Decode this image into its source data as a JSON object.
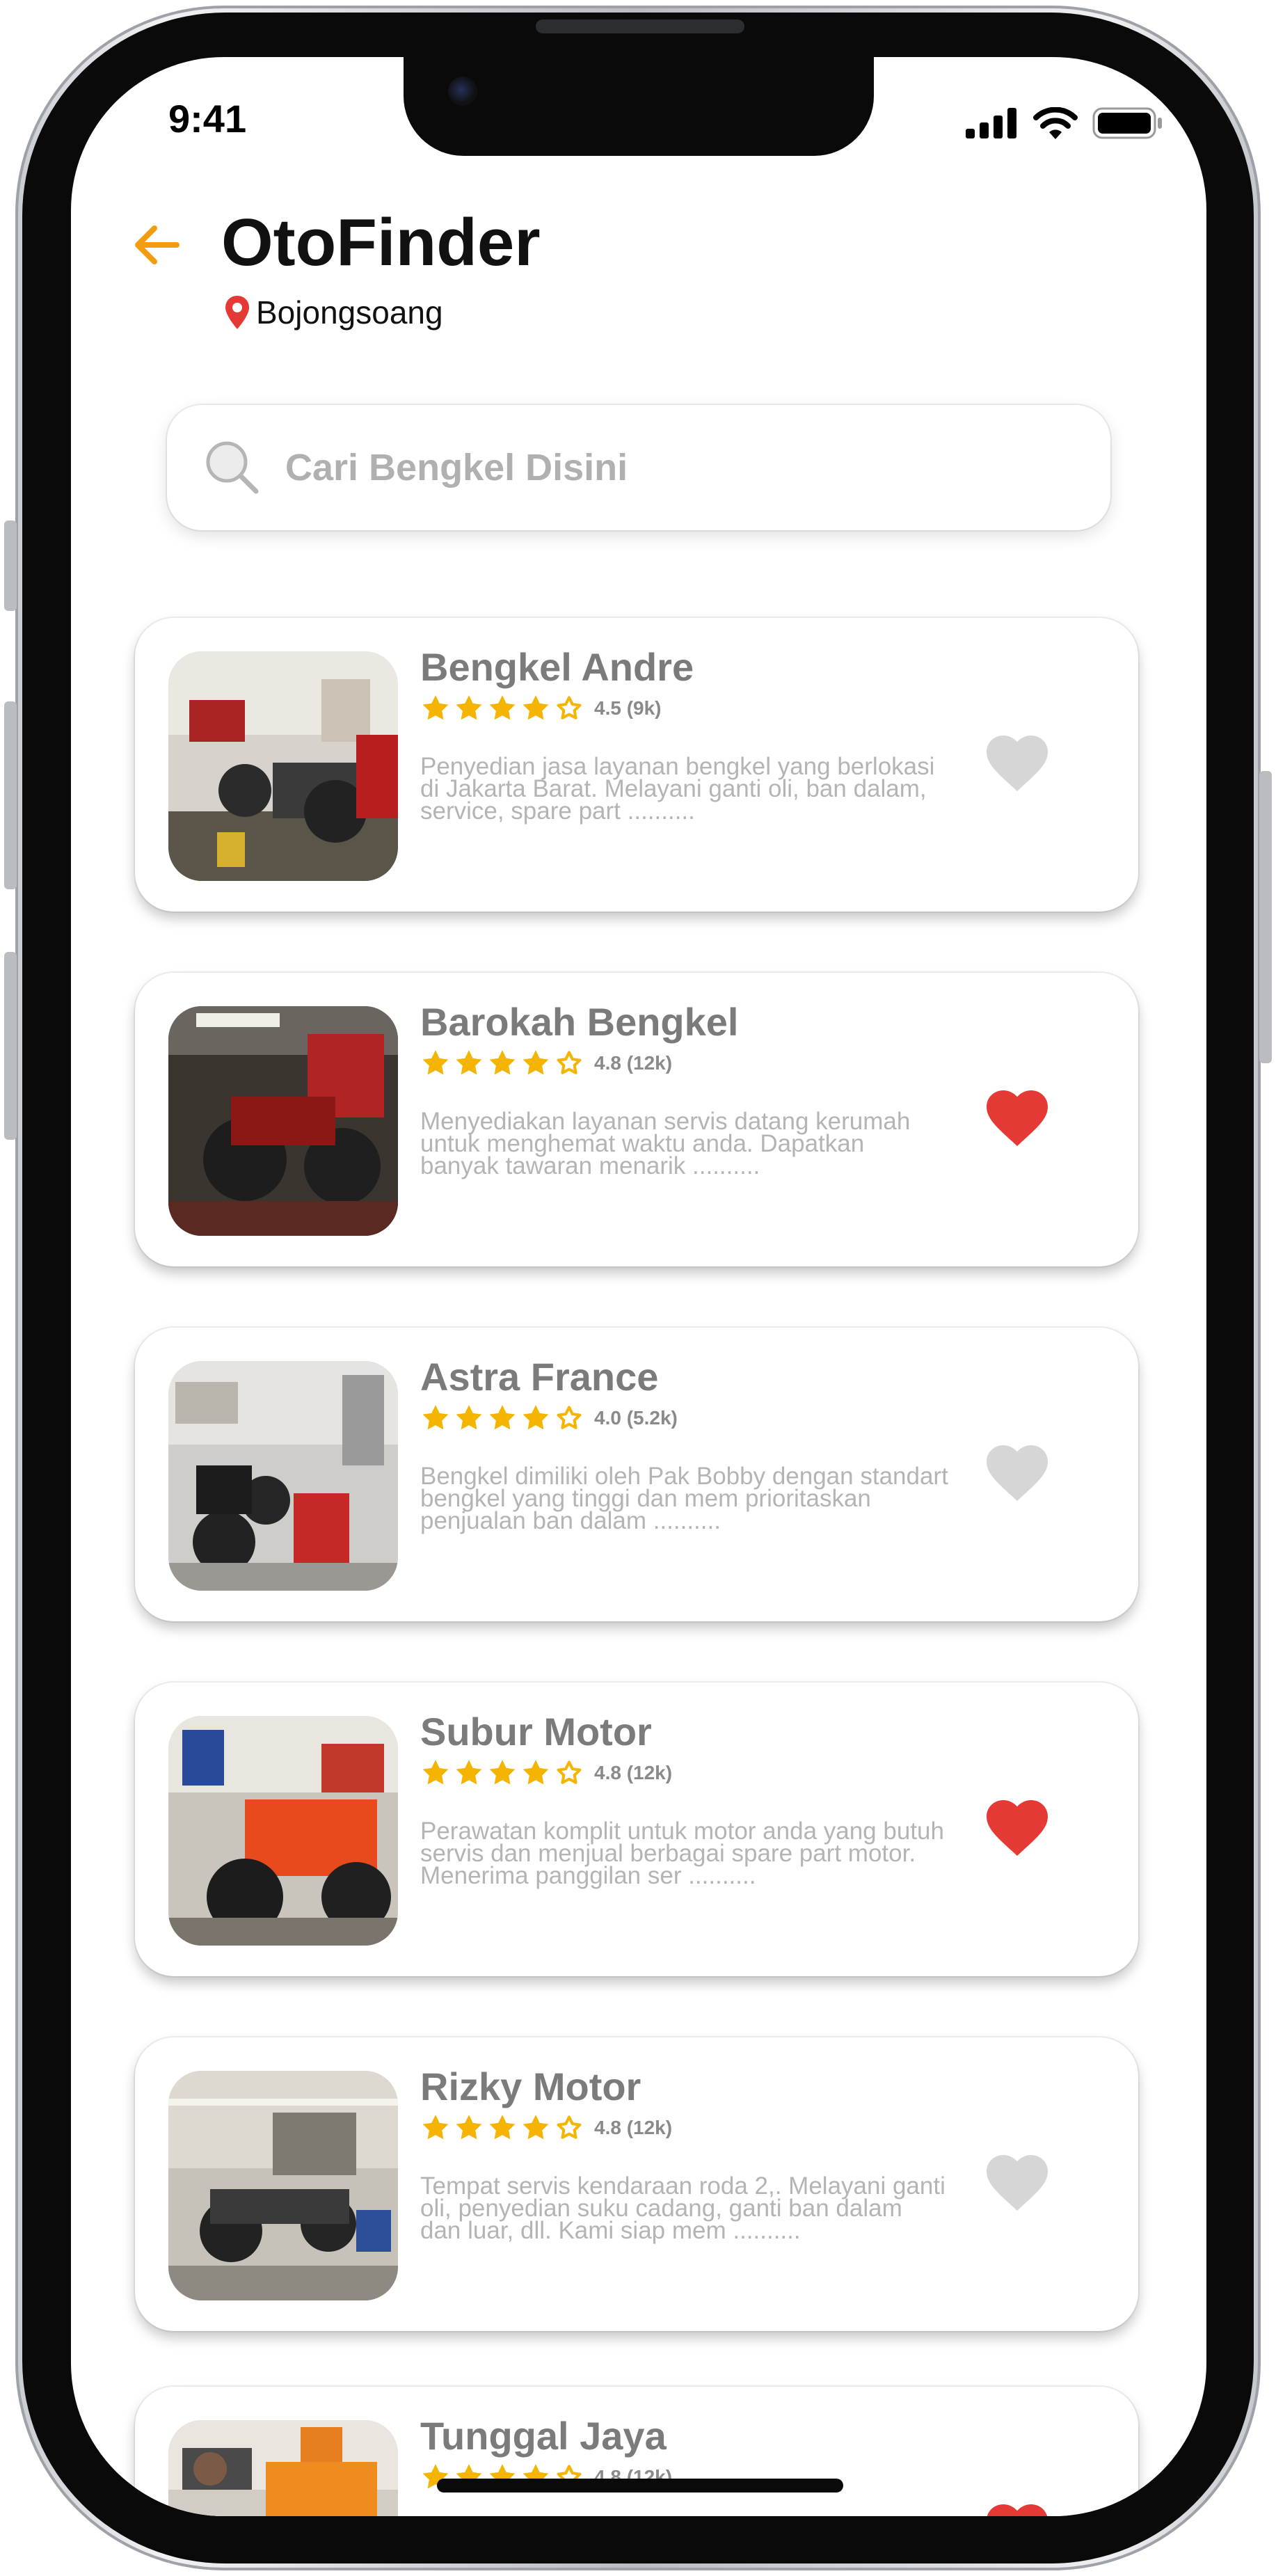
{
  "status_bar": {
    "time": "9:41"
  },
  "header": {
    "title": "OtoFinder",
    "location": "Bojongsoang"
  },
  "search": {
    "placeholder": "Cari Bengkel Disini"
  },
  "colors": {
    "accent": "#F39C12",
    "star": "#F4B400",
    "heart_active": "#E53935",
    "heart_inactive": "#D6D6D6",
    "pin": "#E53935"
  },
  "workshops": [
    {
      "name": "Bengkel Andre",
      "rating": "4.5 (9k)",
      "description": "Penyedian jasa layanan bengkel yang berlokasi di Jakarta Barat. Melayani ganti oli, ban dalam, service, spare part ..........",
      "favorite": false
    },
    {
      "name": "Barokah Bengkel",
      "rating": "4.8 (12k)",
      "description": "Menyediakan layanan servis datang kerumah untuk menghemat waktu anda. Dapatkan banyak tawaran menarik ..........",
      "favorite": true
    },
    {
      "name": "Astra France",
      "rating": "4.0 (5.2k)",
      "description": "Bengkel dimiliki oleh Pak Bobby dengan standart bengkel yang tinggi dan mem prioritaskan penjualan ban dalam ..........",
      "favorite": false
    },
    {
      "name": "Subur Motor",
      "rating": "4.8 (12k)",
      "description": "Perawatan komplit untuk motor anda yang butuh servis dan menjual berbagai spare part motor. Menerima panggilan ser ..........",
      "favorite": true
    },
    {
      "name": "Rizky Motor",
      "rating": "4.8 (12k)",
      "description": "Tempat servis kendaraan roda 2,. Melayani ganti oli, penyedian suku cadang, ganti ban dalam dan luar, dll. Kami siap mem ..........",
      "favorite": false
    },
    {
      "name": "Tunggal Jaya",
      "rating": "4.8 (12k)",
      "description": "",
      "favorite": true
    }
  ]
}
